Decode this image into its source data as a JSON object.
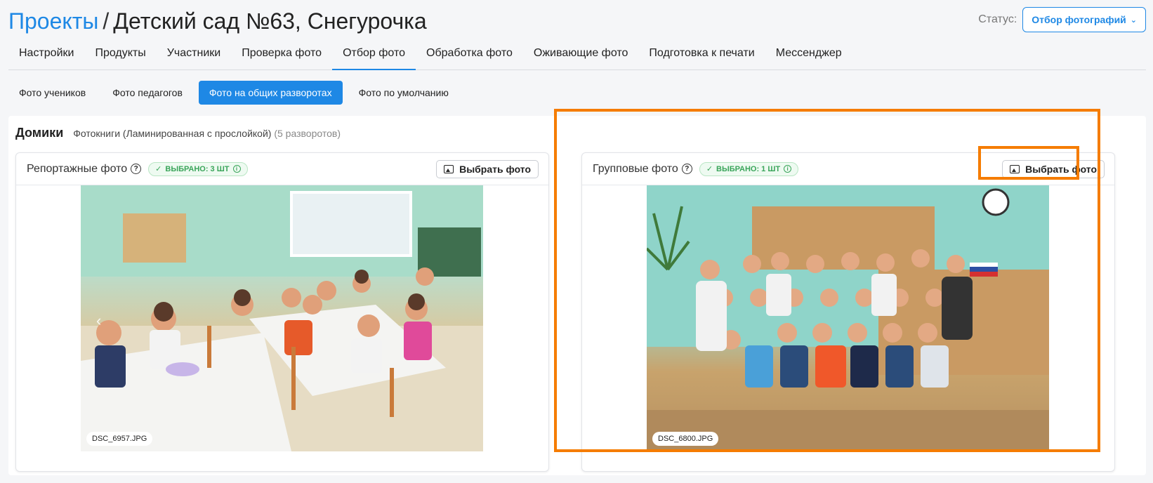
{
  "header": {
    "breadcrumb_root": "Проекты",
    "separator": "/",
    "project_title": "Детский сад №63, Снегурочка",
    "status_label": "Статус:",
    "status_value": "Отбор фотографий"
  },
  "tabs": [
    {
      "label": "Настройки"
    },
    {
      "label": "Продукты"
    },
    {
      "label": "Участники"
    },
    {
      "label": "Проверка фото"
    },
    {
      "label": "Отбор фото",
      "active": true
    },
    {
      "label": "Обработка фото"
    },
    {
      "label": "Оживающие фото"
    },
    {
      "label": "Подготовка к печати"
    },
    {
      "label": "Мессенджер"
    }
  ],
  "subtabs": [
    {
      "label": "Фото учеников"
    },
    {
      "label": "Фото педагогов"
    },
    {
      "label": "Фото на общих разворотах",
      "active": true
    },
    {
      "label": "Фото по умолчанию"
    }
  ],
  "section": {
    "title": "Домики",
    "subtitle": "Фотокниги (Ламинированная с прослойкой)",
    "count": "(5 разворотов)"
  },
  "cards": {
    "left": {
      "title": "Репортажные фото",
      "badge": "ВЫБРАНО: 3 ШТ",
      "button": "Выбрать фото",
      "filename": "DSC_6957.JPG"
    },
    "right": {
      "title": "Групповые фото",
      "badge": "ВЫБРАНО: 1 ШТ",
      "button": "Выбрать фото",
      "filename": "DSC_6800.JPG"
    }
  },
  "colors": {
    "accent": "#1e88e5",
    "success": "#3aa55a",
    "highlight": "#f57c00"
  }
}
